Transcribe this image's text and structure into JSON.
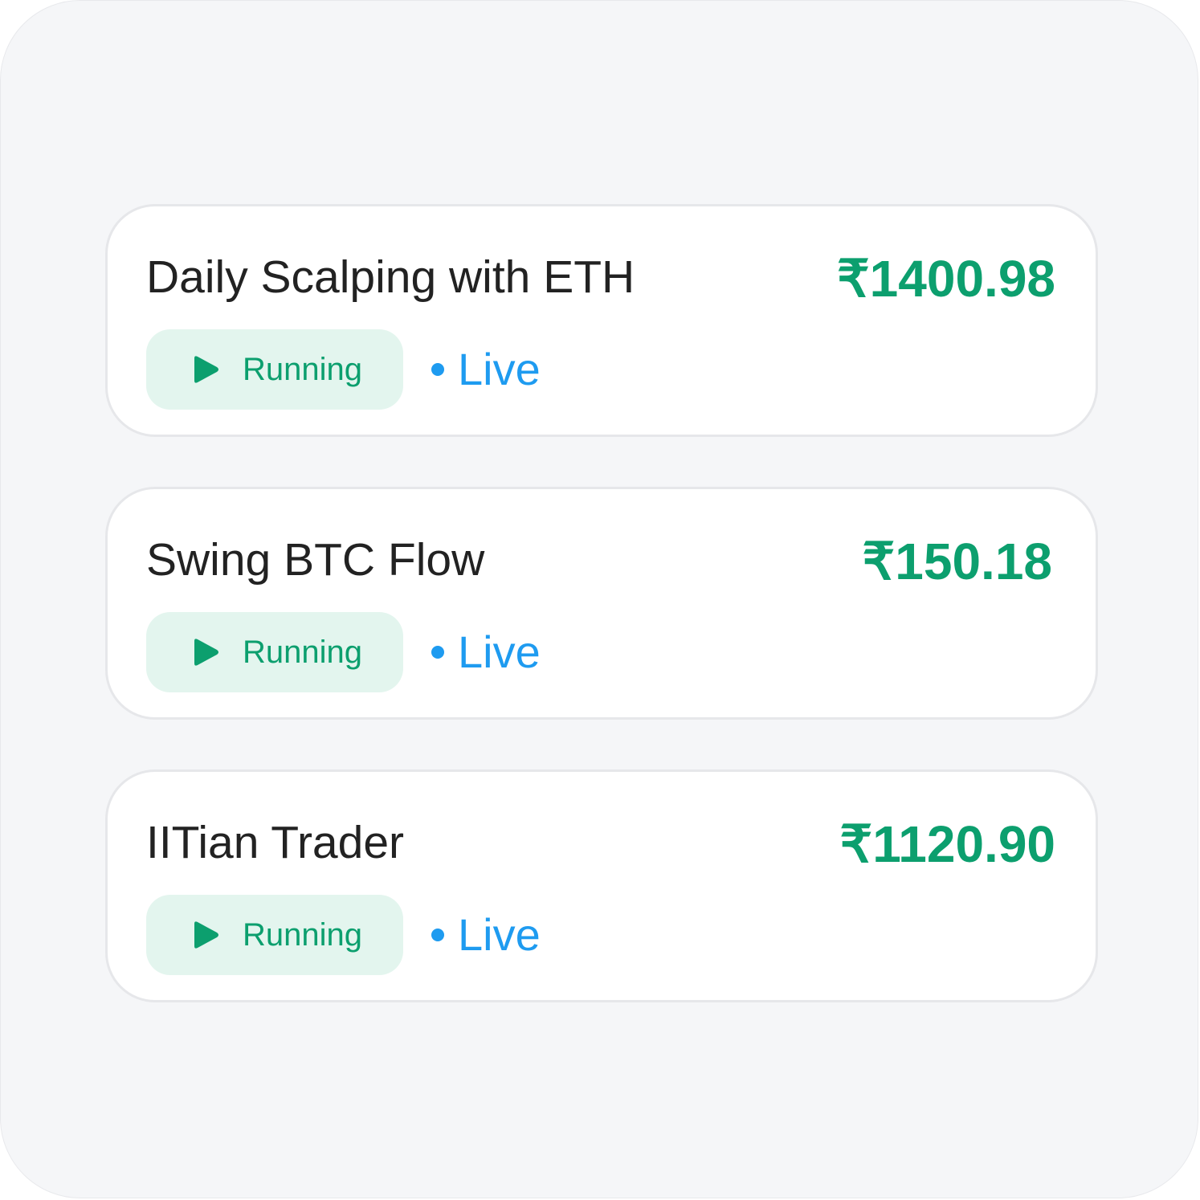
{
  "theme": {
    "accent_green": "#0c9f6e",
    "pill_background": "#e3f5ee",
    "live_blue": "#1e9bf0",
    "title_color": "#222222",
    "page_background": "#f5f6f8"
  },
  "strategies": [
    {
      "title": "Daily Scalping with ETH",
      "amount": "₹1400.98",
      "status_icon": "play-icon",
      "status_label": "Running",
      "mode_label": "Live"
    },
    {
      "title": "Swing BTC Flow",
      "amount": "₹150.18",
      "status_icon": "play-icon",
      "status_label": "Running",
      "mode_label": "Live"
    },
    {
      "title": "IITian Trader",
      "amount": "₹1120.90",
      "status_icon": "play-icon",
      "status_label": "Running",
      "mode_label": "Live"
    }
  ]
}
